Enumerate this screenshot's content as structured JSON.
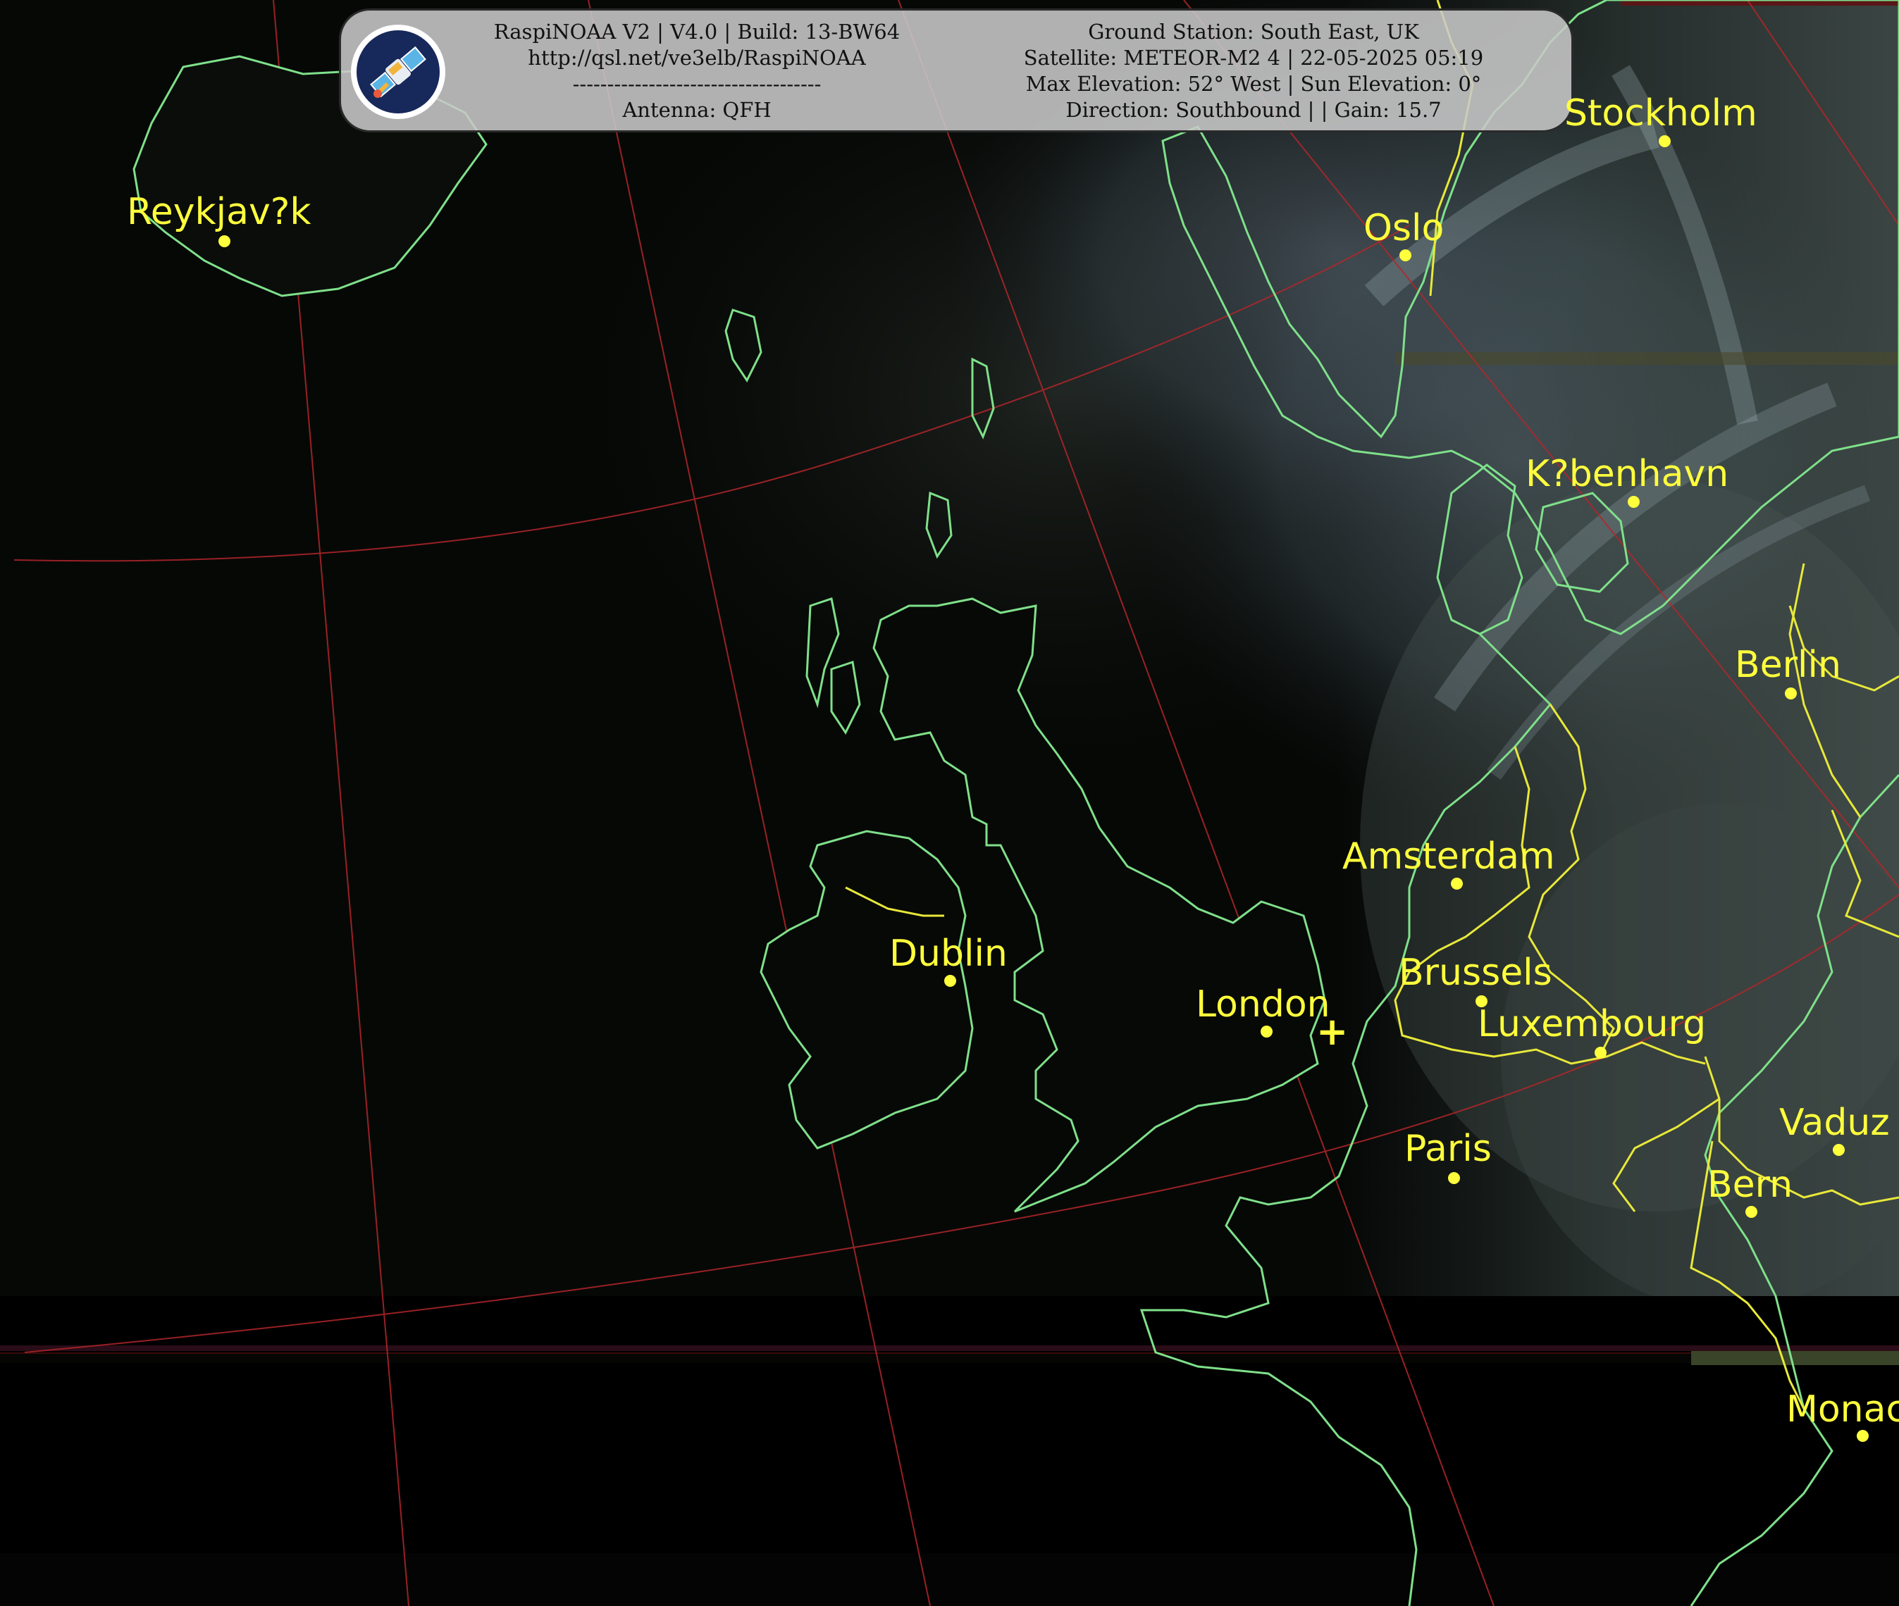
{
  "header": {
    "left_lines": [
      "RaspiNOAA V2 | V4.0 | Build: 13-BW64",
      "http://qsl.net/ve3elb/RaspiNOAA",
      "------------------------------------",
      "Antenna: QFH"
    ],
    "right_lines": [
      "Ground Station: South East, UK",
      "Satellite: METEOR-M2 4 | 22-05-2025 05:19",
      "Max Elevation: 52° West | Sun Elevation: 0°",
      "Direction: Southbound | | Gain: 15.7"
    ]
  },
  "map": {
    "ground_station_marker": "+",
    "cities": [
      {
        "id": "reykjavik",
        "name": "Reykjav?k"
      },
      {
        "id": "stockholm",
        "name": "Stockholm"
      },
      {
        "id": "oslo",
        "name": "Oslo"
      },
      {
        "id": "kobenhavn",
        "name": "K?benhavn"
      },
      {
        "id": "berlin",
        "name": "Berlin"
      },
      {
        "id": "amsterdam",
        "name": "Amsterdam"
      },
      {
        "id": "dublin",
        "name": "Dublin"
      },
      {
        "id": "brussels",
        "name": "Brussels"
      },
      {
        "id": "london",
        "name": "London"
      },
      {
        "id": "luxembourg",
        "name": "Luxembourg"
      },
      {
        "id": "paris",
        "name": "Paris"
      },
      {
        "id": "vaduz",
        "name": "Vaduz"
      },
      {
        "id": "bern",
        "name": "Bern"
      },
      {
        "id": "monaco",
        "name": "Monac"
      }
    ],
    "colors": {
      "coastline": "#7fe08a",
      "border": "#e8e83a",
      "graticule": "#b3262a",
      "label": "#ffff3c"
    }
  }
}
